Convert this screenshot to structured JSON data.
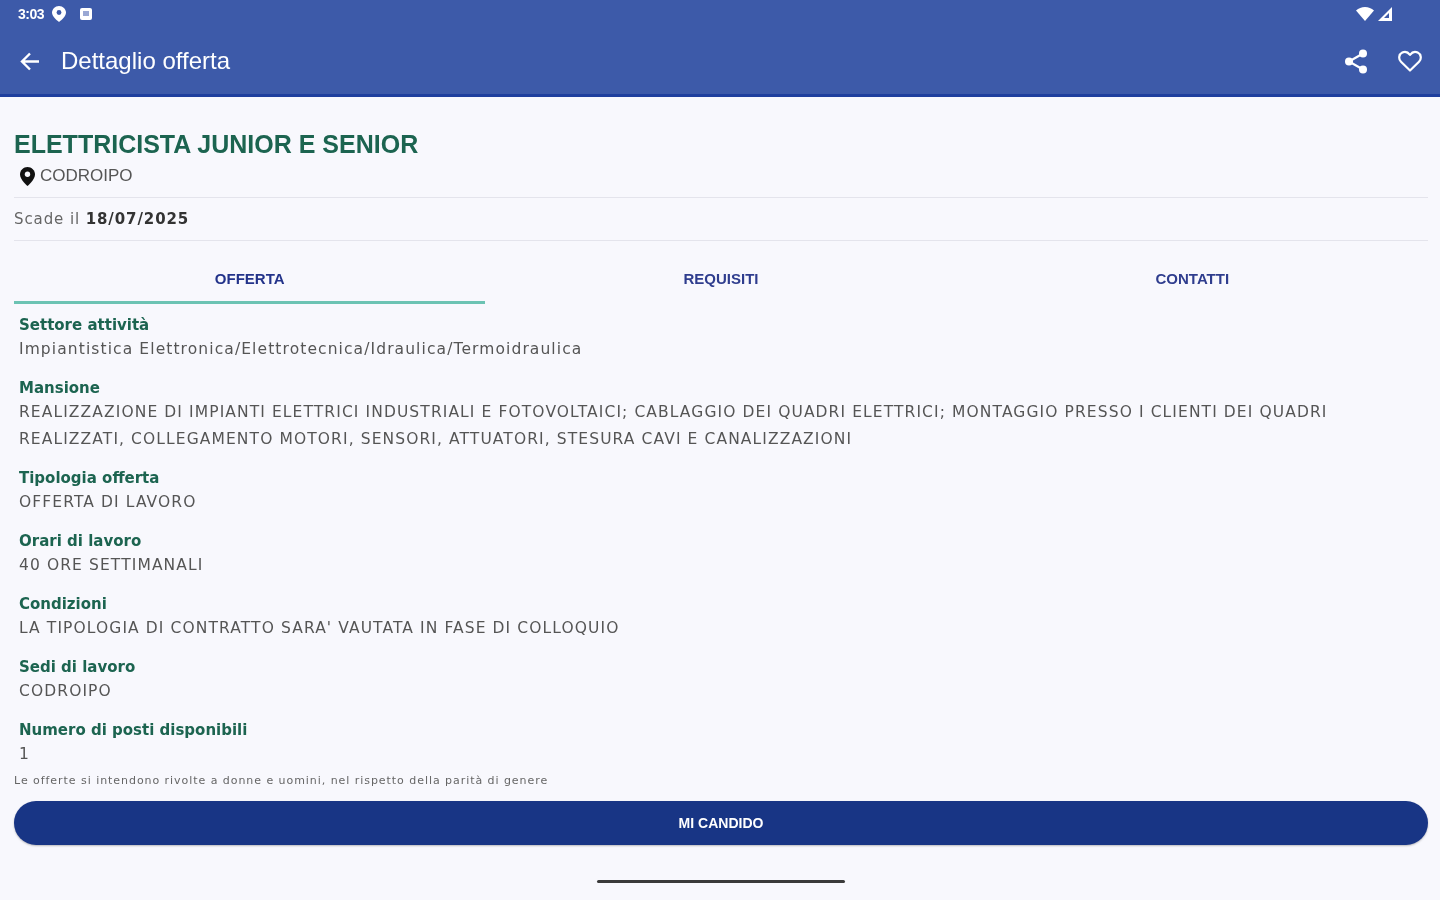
{
  "status_bar": {
    "time": "3:03"
  },
  "app_bar": {
    "title": "Dettaglio offerta"
  },
  "offer": {
    "title": "ELETTRICISTA JUNIOR E SENIOR",
    "location": "CODROIPO",
    "expiry": "Scade il **18/07/2025**"
  },
  "tabs": [
    {
      "label": "OFFERTA",
      "selected": true
    },
    {
      "label": "REQUISITI",
      "selected": false
    },
    {
      "label": "CONTATTI",
      "selected": false
    }
  ],
  "fields": [
    {
      "label": "Settore attività",
      "value": "Impiantistica Elettronica/Elettrotecnica/Idraulica/Termoidraulica"
    },
    {
      "label": "Mansione",
      "value": "REALIZZAZIONE DI IMPIANTI ELETTRICI INDUSTRIALI E FOTOVOLTAICI; CABLAGGIO DEI QUADRI ELETTRICI; MONTAGGIO PRESSO I CLIENTI DEI QUADRI REALIZZATI, COLLEGAMENTO MOTORI, SENSORI, ATTUATORI, STESURA CAVI E CANALIZZAZIONI"
    },
    {
      "label": "Tipologia offerta",
      "value": "OFFERTA DI LAVORO"
    },
    {
      "label": "Orari di lavoro",
      "value": "40 ORE SETTIMANALI"
    },
    {
      "label": "Condizioni",
      "value": "LA TIPOLOGIA DI CONTRATTO SARA' VAUTATA IN FASE DI COLLOQUIO"
    },
    {
      "label": "Sedi di lavoro",
      "value": "CODROIPO"
    },
    {
      "label": "Numero di posti disponibili",
      "value": "1"
    }
  ],
  "note": "Le offerte si intendono rivolte a donne e uomini, nel rispetto della parità di genere",
  "apply_button": {
    "label": "MI CANDIDO"
  }
}
